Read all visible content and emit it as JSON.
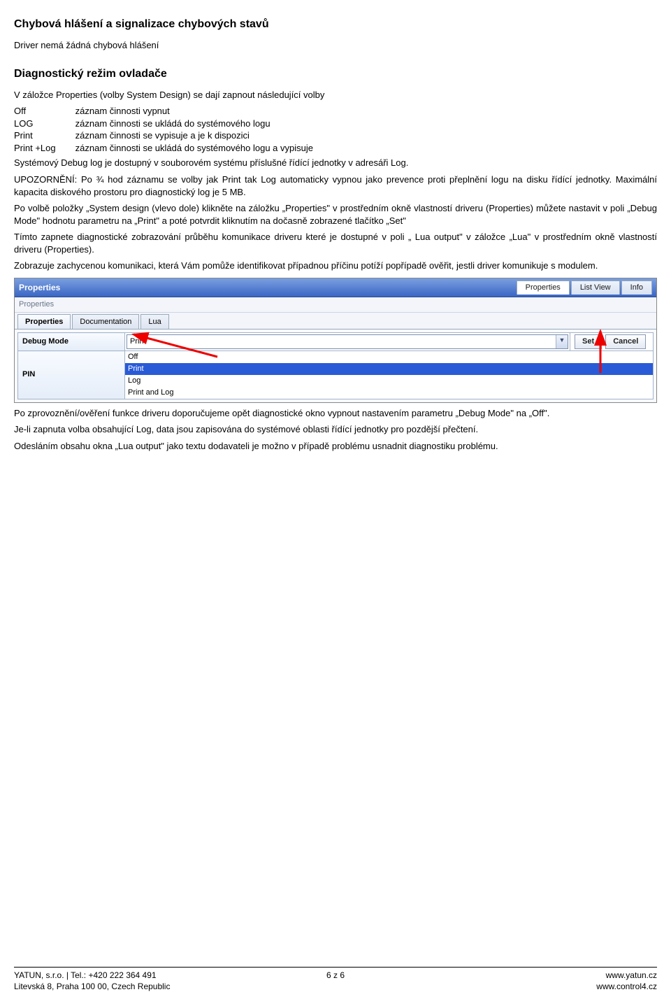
{
  "heading1": "Chybová hlášení a signalizace chybových stavů",
  "p1": "Driver nemá žádná chybová hlášení",
  "heading2": "Diagnostický režim ovladače",
  "p2": "V záložce Properties (volby System Design) se dají zapnout následující volby",
  "defs": [
    {
      "k": "Off",
      "v": "záznam činnosti vypnut"
    },
    {
      "k": "LOG",
      "v": "záznam činnosti se ukládá do systémového logu"
    },
    {
      "k": "Print",
      "v": "záznam činnosti se vypisuje a je k dispozici"
    },
    {
      "k": "Print +Log",
      "v": "záznam činnosti se ukládá do systémového logu a vypisuje"
    }
  ],
  "p3": "Systémový Debug log je dostupný v souborovém systému příslušné řídící jednotky v adresáři Log.",
  "p4": "UPOZORNĚNÍ: Po ¾ hod záznamu se volby jak Print tak Log automaticky vypnou jako prevence proti přeplnění logu na disku řídící jednotky. Maximální kapacita diskového prostoru pro diagnostický log je 5 MB.",
  "p5": "Po volbě položky „System design (vlevo dole) klikněte na záložku „Properties\" v prostředním okně vlastností driveru (Properties) můžete nastavit v poli „Debug Mode\" hodnotu parametru na „Print\" a poté potvrdit kliknutím na dočasně zobrazené tlačítko „Set\"",
  "p6": "Tímto zapnete diagnostické zobrazování průběhu komunikace driveru které je dostupné v poli „ Lua output\" v záložce „Lua\" v prostředním okně vlastností driveru (Properties).",
  "p7": "Zobrazuje zachycenou komunikaci, která Vám pomůže identifikovat případnou příčinu potíží popřípadě ověřit, jestli driver komunikuje s modulem.",
  "shot": {
    "title": "Properties",
    "tabs_right": [
      "Properties",
      "List View",
      "Info"
    ],
    "sub_label": "Properties",
    "subtabs": [
      "Properties",
      "Documentation",
      "Lua"
    ],
    "rows": {
      "debug_mode": {
        "label": "Debug Mode",
        "value": "Print"
      },
      "pin": {
        "label": "PIN"
      }
    },
    "buttons": {
      "set": "Set",
      "cancel": "Cancel"
    },
    "options": [
      "Off",
      "Print",
      "Log",
      "Print and Log"
    ]
  },
  "p8": "Po zprovoznění/ověření funkce driveru doporučujeme opět diagnostické okno vypnout nastavením parametru „Debug Mode\" na „Off\".",
  "p9": "Je-li zapnuta volba obsahující Log, data jsou zapisována do systémové oblasti řídící jednotky pro pozdější přečtení.",
  "p10": "Odesláním obsahu okna „Lua output\" jako textu dodavateli je možno v případě problému usnadnit diagnostiku problému.",
  "footer": {
    "left1": "YATUN, s.r.o. | Tel.: +420 222 364 491",
    "left2": "Litevská 8, Praha 100 00, Czech Republic",
    "center": "6 z 6",
    "right1": "www.yatun.cz",
    "right2": "www.control4.cz"
  }
}
